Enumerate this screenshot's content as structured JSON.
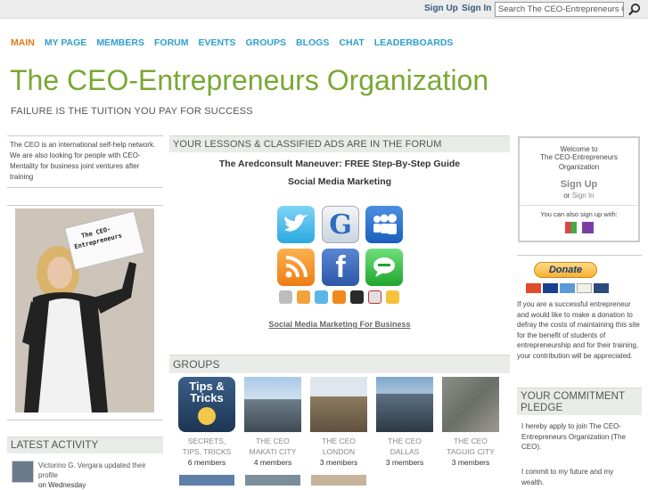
{
  "topbar": {
    "signup": "Sign Up",
    "signin": "Sign In",
    "search_placeholder": "Search The CEO-Entrepreneurs O"
  },
  "nav": [
    {
      "label": "MAIN",
      "active": true
    },
    {
      "label": "MY PAGE"
    },
    {
      "label": "MEMBERS"
    },
    {
      "label": "FORUM"
    },
    {
      "label": "EVENTS"
    },
    {
      "label": "GROUPS"
    },
    {
      "label": "BLOGS"
    },
    {
      "label": "CHAT"
    },
    {
      "label": "LEADERBOARDS"
    }
  ],
  "site": {
    "title": "The CEO-Entrepreneurs Organization",
    "tagline": "FAILURE IS THE TUITION YOU PAY FOR SUCCESS"
  },
  "left": {
    "about": "The CEO is an international self-help network. We are also looking for people with CEO-Mentality for business joint ventures after training",
    "photo_sign": "The CEO-Entrepreneurs",
    "latest_activity_title": "LATEST ACTIVITY",
    "activity": {
      "name": "Victorino G. Vergara",
      "action": " updated their profile",
      "when": "on Wednesday"
    }
  },
  "main": {
    "forum_title": "YOUR LESSONS & CLASSIFIED ADS ARE IN THE FORUM",
    "headline1": "The Aredconsult Maneuver: FREE Step-By-Step Guide",
    "headline2": "Social Media Marketing",
    "social_link": "Social Media Marketing For Business",
    "groups_title": "GROUPS",
    "groups": [
      {
        "name": "SECRETS, TIPS, TRICKS",
        "count": "6 members",
        "thumb_text": "Tips & Tricks"
      },
      {
        "name": "THE CEO MAKATI CITY",
        "count": "4 members"
      },
      {
        "name": "THE CEO LONDON",
        "count": "3 members"
      },
      {
        "name": "THE CEO DALLAS",
        "count": "3 members"
      },
      {
        "name": "THE CEO TAGUIG CITY",
        "count": "3 members"
      }
    ]
  },
  "right": {
    "welcome": "Welcome to",
    "welcome_org": "The CEO-Entrepreneurs Organization",
    "signup": "Sign Up",
    "or": "or",
    "signin": "Sign In",
    "also": "You can also sign up with:",
    "donate": "Donate",
    "donation_text": "If you are a successful entrepreneur and would like to make a donation to defray the costs of maintaining this site for the benefit of students of entrepreneurship and for their training, your contribution will be appreciated.",
    "pledge_title": "YOUR COMMITMENT PLEDGE",
    "pledge1": "I hereby apply to join The CEO-Entrepreneurs Organization (The CEO).",
    "pledge2": "I commit to my future and my wealth."
  }
}
